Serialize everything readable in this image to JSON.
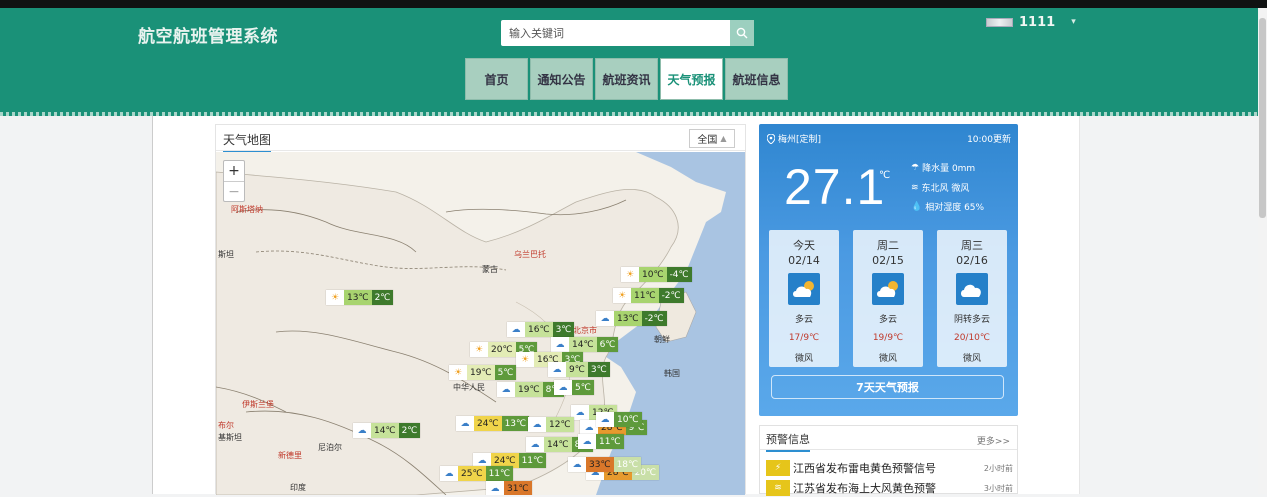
{
  "header": {
    "title": "航空航班管理系统",
    "search_placeholder": "输入关键词",
    "user_name": "1111",
    "nav": [
      "首页",
      "通知公告",
      "航班资讯",
      "天气预报",
      "航班信息"
    ],
    "active_nav": "天气预报"
  },
  "map": {
    "title": "天气地图",
    "scope": "全国",
    "zoom_in": "+",
    "zoom_out": "−",
    "places": [
      {
        "name": "阿斯塔纳",
        "red": true
      },
      {
        "name": "乌兰巴托",
        "red": true
      },
      {
        "name": "蒙古",
        "red": false
      },
      {
        "name": "斯坦",
        "red": false
      },
      {
        "name": "北京市",
        "red": true
      },
      {
        "name": "朝鲜",
        "red": false
      },
      {
        "name": "韩国",
        "red": false
      },
      {
        "name": "中华人民",
        "red": false
      },
      {
        "name": "布尔",
        "red": true
      },
      {
        "name": "伊斯兰堡",
        "red": true
      },
      {
        "name": "基斯坦",
        "red": false
      },
      {
        "name": "尼泊尔",
        "red": false
      },
      {
        "name": "新德里",
        "red": true
      },
      {
        "name": "印度",
        "red": false
      }
    ],
    "labels": [
      {
        "icon": "sun",
        "hi": "10℃",
        "lo": "-4℃",
        "color": "#a8d46f",
        "dark": "#3e7a2c"
      },
      {
        "icon": "sun",
        "hi": "13℃",
        "lo": "2℃",
        "color": "#a8d46f",
        "dark": "#3e7a2c"
      },
      {
        "icon": "sun",
        "hi": "11℃",
        "lo": "-2℃",
        "color": "#a8d46f",
        "dark": "#3e7a2c"
      },
      {
        "icon": "cloud",
        "hi": "13℃",
        "lo": "-2℃",
        "color": "#a8d46f",
        "dark": "#3e7a2c"
      },
      {
        "icon": "cloud",
        "hi": "16℃",
        "lo": "3℃",
        "color": "#c6e29a",
        "dark": "#3e7a2c"
      },
      {
        "icon": "cloud",
        "hi": "14℃",
        "lo": "6℃",
        "color": "#c6e29a",
        "dark": "#5e9a3b"
      },
      {
        "icon": "sun",
        "hi": "20℃",
        "lo": "5℃",
        "color": "#e3ecb5",
        "dark": "#5e9a3b"
      },
      {
        "icon": "sun",
        "hi": "16℃",
        "lo": "3℃",
        "color": "#e3ecb5",
        "dark": "#5e9a3b"
      },
      {
        "icon": "cloud",
        "hi": "9℃",
        "lo": "3℃",
        "color": "#c6e29a",
        "dark": "#3e7a2c"
      },
      {
        "icon": "sun",
        "hi": "19℃",
        "lo": "5℃",
        "color": "#e3ecb5",
        "dark": "#5e9a3b"
      },
      {
        "icon": "cloud",
        "hi": "19℃",
        "lo": "8℃",
        "color": "#c6e29a",
        "dark": "#5e9a3b"
      },
      {
        "icon": "cloud",
        "hi": "",
        "lo": "5℃",
        "color": "#c6e29a",
        "dark": "#5e9a3b"
      },
      {
        "icon": "cloud",
        "hi": "14℃",
        "lo": "2℃",
        "color": "#c6e29a",
        "dark": "#3e7a2c"
      },
      {
        "icon": "cloud",
        "hi": "12℃",
        "lo": "",
        "color": "#c6e29a",
        "dark": "#5e9a3b"
      },
      {
        "icon": "cloud",
        "hi": "24℃",
        "lo": "13℃",
        "color": "#f0d44a",
        "dark": "#5e9a3b"
      },
      {
        "icon": "cloud",
        "hi": "12℃",
        "lo": "",
        "color": "#c6e29a",
        "dark": "#5e9a3b"
      },
      {
        "icon": "cloud",
        "hi": "28℃",
        "lo": "9℃",
        "color": "#e69a2e",
        "dark": "#5e9a3b"
      },
      {
        "icon": "cloud",
        "hi": "",
        "lo": "10℃",
        "color": "#c6e29a",
        "dark": "#5e9a3b"
      },
      {
        "icon": "cloud",
        "hi": "14℃",
        "lo": "8℃",
        "color": "#c6e29a",
        "dark": "#5e9a3b"
      },
      {
        "icon": "cloud",
        "hi": "",
        "lo": "11℃",
        "color": "#c6e29a",
        "dark": "#5e9a3b"
      },
      {
        "icon": "cloud",
        "hi": "24℃",
        "lo": "11℃",
        "color": "#f0d44a",
        "dark": "#5e9a3b"
      },
      {
        "icon": "cloud",
        "hi": "25℃",
        "lo": "11℃",
        "color": "#f0d44a",
        "dark": "#5e9a3b"
      },
      {
        "icon": "cloud",
        "hi": "28℃",
        "lo": "20℃",
        "color": "#e69a2e",
        "dark": "#c9dfa8"
      },
      {
        "icon": "cloud",
        "hi": "33℃",
        "lo": "18℃",
        "color": "#d9772a",
        "dark": "#c9dfa8"
      },
      {
        "icon": "cloud",
        "hi": "31℃",
        "lo": "",
        "color": "#d9772a",
        "dark": "#c9dfa8"
      }
    ]
  },
  "weather": {
    "location": "梅州[定制]",
    "updated": "10:00更新",
    "temp": "27.1",
    "unit": "℃",
    "rain": "降水量 0mm",
    "wind": "东北风 微风",
    "humidity": "相对湿度 65%",
    "days": [
      {
        "name": "今天",
        "date": "02/14",
        "weather": "多云",
        "temps": "17/9℃",
        "wind": "微风"
      },
      {
        "name": "周二",
        "date": "02/15",
        "weather": "多云",
        "temps": "19/9℃",
        "wind": "微风"
      },
      {
        "name": "周三",
        "date": "02/16",
        "weather": "阴转多云",
        "temps": "20/10℃",
        "wind": "微风"
      }
    ],
    "seven_day": "7天天气预报"
  },
  "alerts": {
    "title": "预警信息",
    "more": "更多>>",
    "items": [
      {
        "text": "江西省发布雷电黄色预警信号",
        "time": "2小时前"
      },
      {
        "text": "江苏省发布海上大风黄色预警",
        "time": "3小时前"
      }
    ]
  },
  "colors": {
    "header_bg": "#1a9178",
    "accent_blue": "#2d8fd1",
    "weather_card": "#3a8fd8",
    "alert_yellow": "#e6c51a"
  }
}
